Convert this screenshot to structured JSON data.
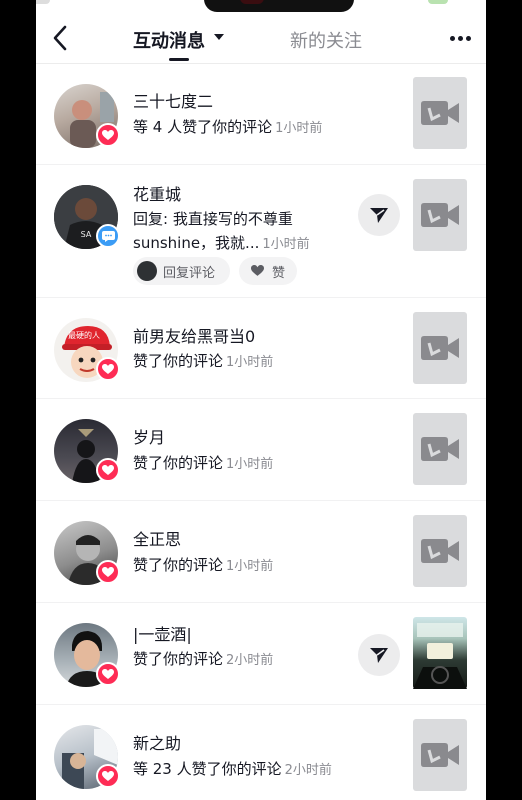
{
  "header": {
    "active_tab": "互动消息",
    "inactive_tab": "新的关注"
  },
  "notifications": [
    {
      "name": "三十七度二",
      "text": "等 4 人赞了你的评论",
      "time": "1小时前",
      "badge": "heart"
    },
    {
      "name": "花重城",
      "text": "回复: 我直接写的不尊重",
      "text2": "sunshine，我就...",
      "time": "1小时前",
      "badge": "comment",
      "action_reply": "回复评论",
      "action_like": "赞"
    },
    {
      "name": "前男友给黑哥当0",
      "text": "赞了你的评论",
      "time": "1小时前",
      "badge": "heart",
      "avatar_text": "最硬的人"
    },
    {
      "name": "岁月",
      "text": "赞了你的评论",
      "time": "1小时前",
      "badge": "heart"
    },
    {
      "name": "全正思",
      "text": "赞了你的评论",
      "time": "1小时前",
      "badge": "heart"
    },
    {
      "name": "|一壶酒|",
      "text": "赞了你的评论",
      "time": "2小时前",
      "badge": "heart"
    },
    {
      "name": "新之助",
      "text": "等 23 人赞了你的评论",
      "time": "2小时前",
      "badge": "heart"
    }
  ],
  "colors": {
    "like": "#fe2c55",
    "comment": "#3b9cf5",
    "text": "#161823",
    "secondary": "#8a8b91"
  }
}
